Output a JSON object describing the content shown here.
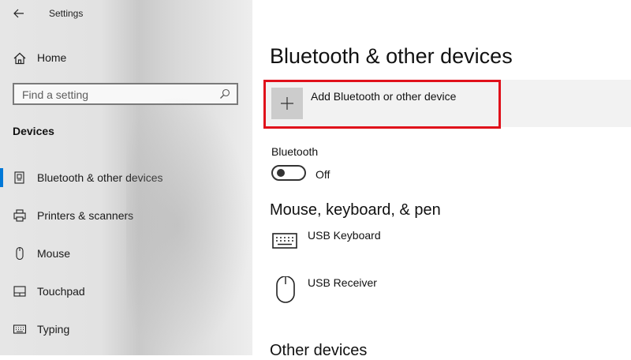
{
  "window": {
    "title": "Settings"
  },
  "sidebar": {
    "home_label": "Home",
    "search": {
      "placeholder": "Find a setting",
      "value": ""
    },
    "section_title": "Devices",
    "items": [
      {
        "label": "Bluetooth & other devices",
        "icon": "bluetooth-devices-icon",
        "selected": true
      },
      {
        "label": "Printers & scanners",
        "icon": "printer-icon",
        "selected": false
      },
      {
        "label": "Mouse",
        "icon": "mouse-icon",
        "selected": false
      },
      {
        "label": "Touchpad",
        "icon": "touchpad-icon",
        "selected": false
      },
      {
        "label": "Typing",
        "icon": "keyboard-icon",
        "selected": false
      }
    ]
  },
  "main": {
    "title": "Bluetooth & other devices",
    "add_device_label": "Add Bluetooth or other device",
    "bluetooth": {
      "label": "Bluetooth",
      "state": "Off"
    },
    "mouse_section_title": "Mouse, keyboard, & pen",
    "devices": [
      {
        "label": "USB Keyboard",
        "icon": "keyboard-icon"
      },
      {
        "label": "USB Receiver",
        "icon": "mouse-icon"
      }
    ],
    "other_section_title": "Other devices"
  },
  "colors": {
    "accent": "#0078d7",
    "highlight": "#e0101a",
    "sidebar_bg": "#e6e6e6"
  }
}
